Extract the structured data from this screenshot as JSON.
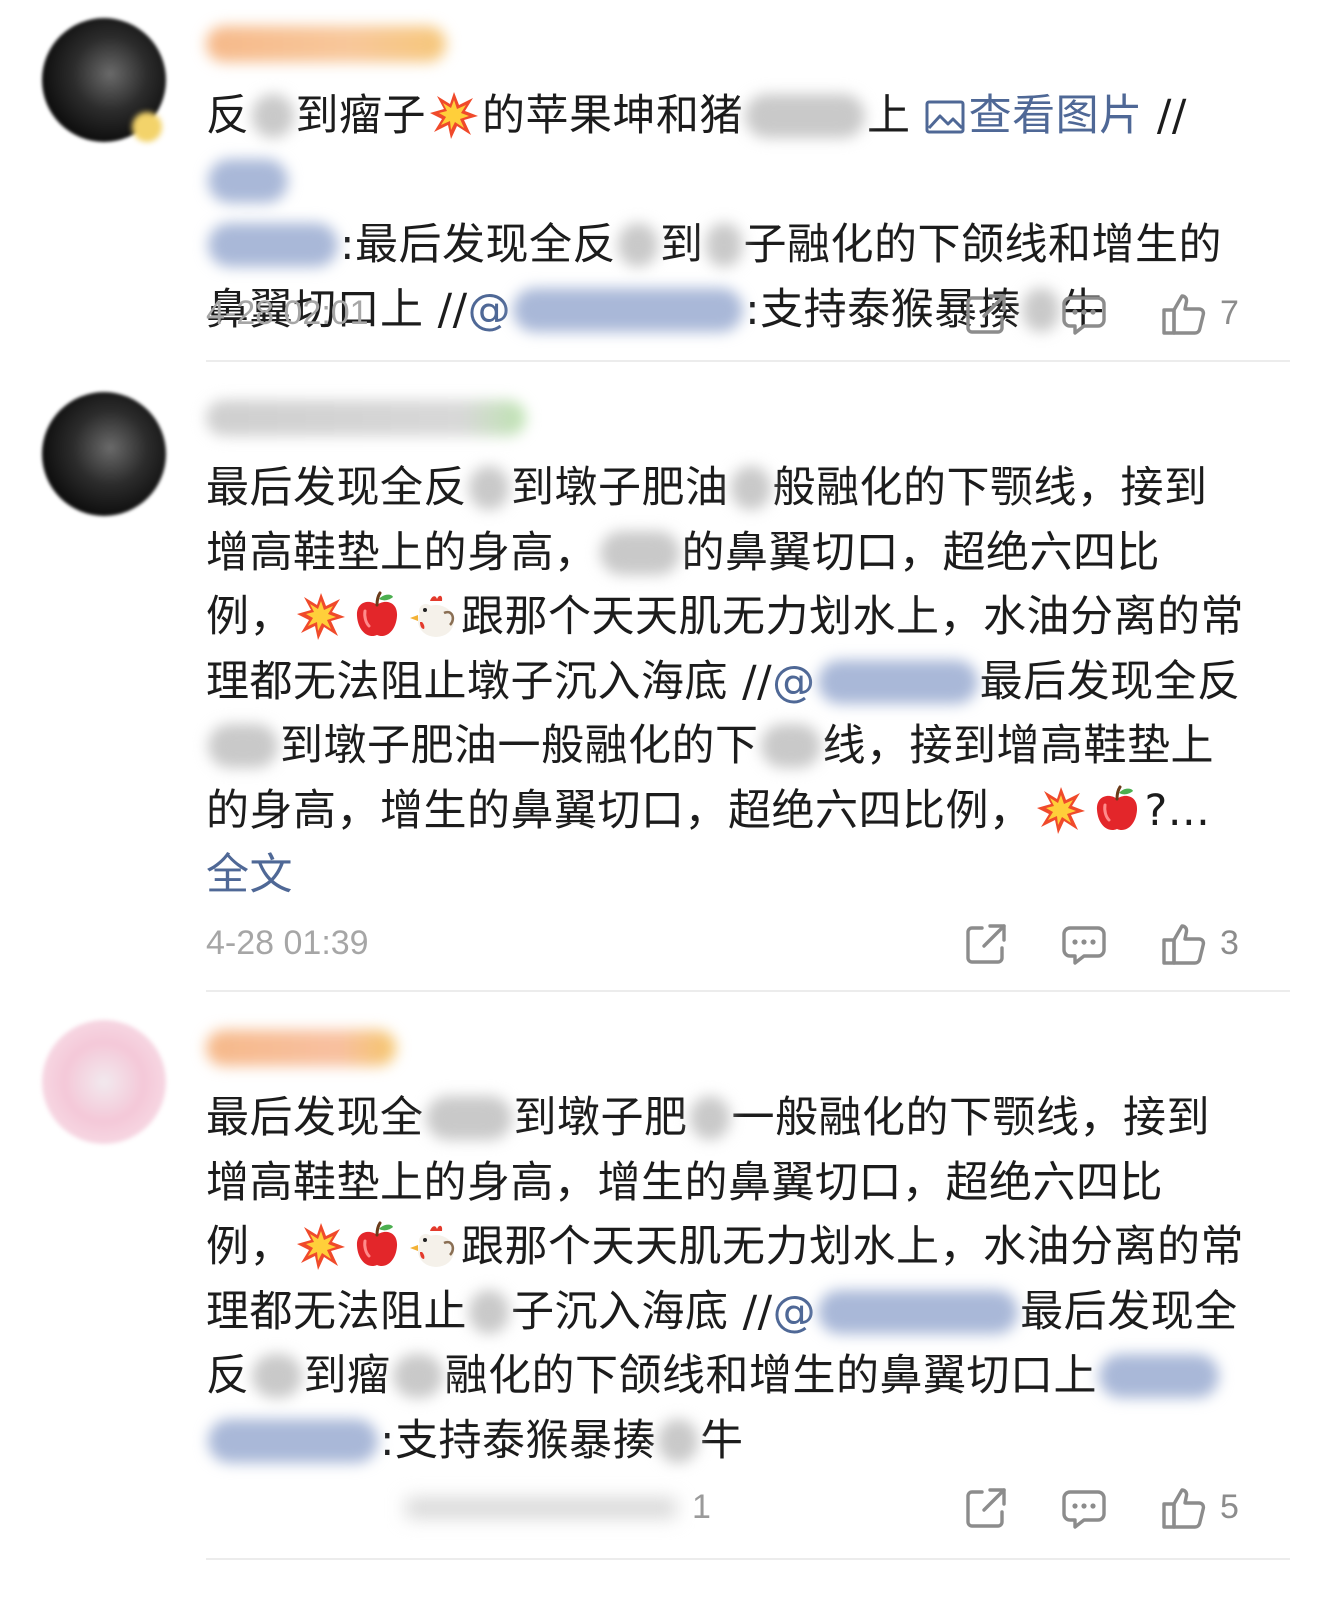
{
  "comments": [
    {
      "text_parts": [
        "反",
        "到瘤子",
        "的苹果坤和猪",
        "上 ",
        "查看图片",
        " //",
        ":最后发现全反",
        "到",
        "子融化的下颌线和增生的",
        "鼻翼切口上 //",
        "@",
        ":支持泰猴暴揍",
        "牛"
      ],
      "timestamp": "4-28 02:01",
      "like_count": "7"
    },
    {
      "text_parts": [
        "最后发现全反",
        "到墩子肥油",
        "般融化的下颚线，接到增高鞋垫上的身高，",
        "的鼻翼切口，超绝六四比例，",
        "跟那个天天肌无力划水上，水油分离的常理都无法阻止墩子沉入海底 //",
        "@",
        "最后发现全反",
        "到墩子肥油一般融化的下",
        "线，接到增高鞋垫上的身高，增生的鼻翼切口，超绝六四比例，",
        "?..."
      ],
      "full_text_link": "全文",
      "timestamp": "4-28 01:39",
      "like_count": "3"
    },
    {
      "text_parts": [
        "最后发现全",
        "到墩子肥",
        "一般融化的下颚线，接到增高鞋垫上的身高，增生的鼻翼切口，超绝六四比例，",
        "跟那个天天肌无力划水上，水油分离的常理都无法阻止",
        "子沉入海底 //",
        "@",
        "最后发现全反",
        "到瘤",
        "融化的下颌线和增生的鼻翼切口上",
        ":支持泰猴暴揍",
        "牛"
      ],
      "reply_count": "1",
      "like_count": "5"
    }
  ],
  "icons": {
    "share": "share-icon",
    "comment": "comment-icon",
    "like": "thumbs-up-icon",
    "image": "image-icon",
    "emoji_boom": "collision-emoji",
    "emoji_apple": "red-apple-emoji",
    "emoji_rooster": "rooster-emoji"
  },
  "colors": {
    "link": "#4f6896",
    "timestamp": "#a6a6a6",
    "text": "#1c1c1c",
    "divider": "#ececec"
  }
}
